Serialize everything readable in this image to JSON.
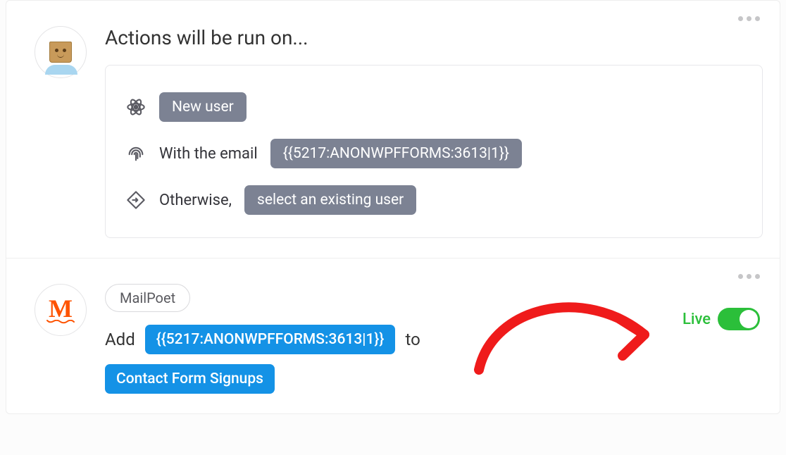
{
  "top": {
    "heading": "Actions will be run on...",
    "rules": {
      "new_user_label": "New user",
      "with_email_text": "With the email",
      "email_token": "{{5217:ANONWPFFORMS:3613|1}}",
      "otherwise_text": "Otherwise,",
      "fallback_label": "select an existing user"
    }
  },
  "bottom": {
    "integration_tag": "MailPoet",
    "avatar_letter": "M",
    "add_text": "Add",
    "user_token": "{{5217:ANONWPFFORMS:3613|1}}",
    "to_text": "to",
    "list_name": "Contact Form Signups",
    "live_label": "Live",
    "toggle_on": true
  }
}
